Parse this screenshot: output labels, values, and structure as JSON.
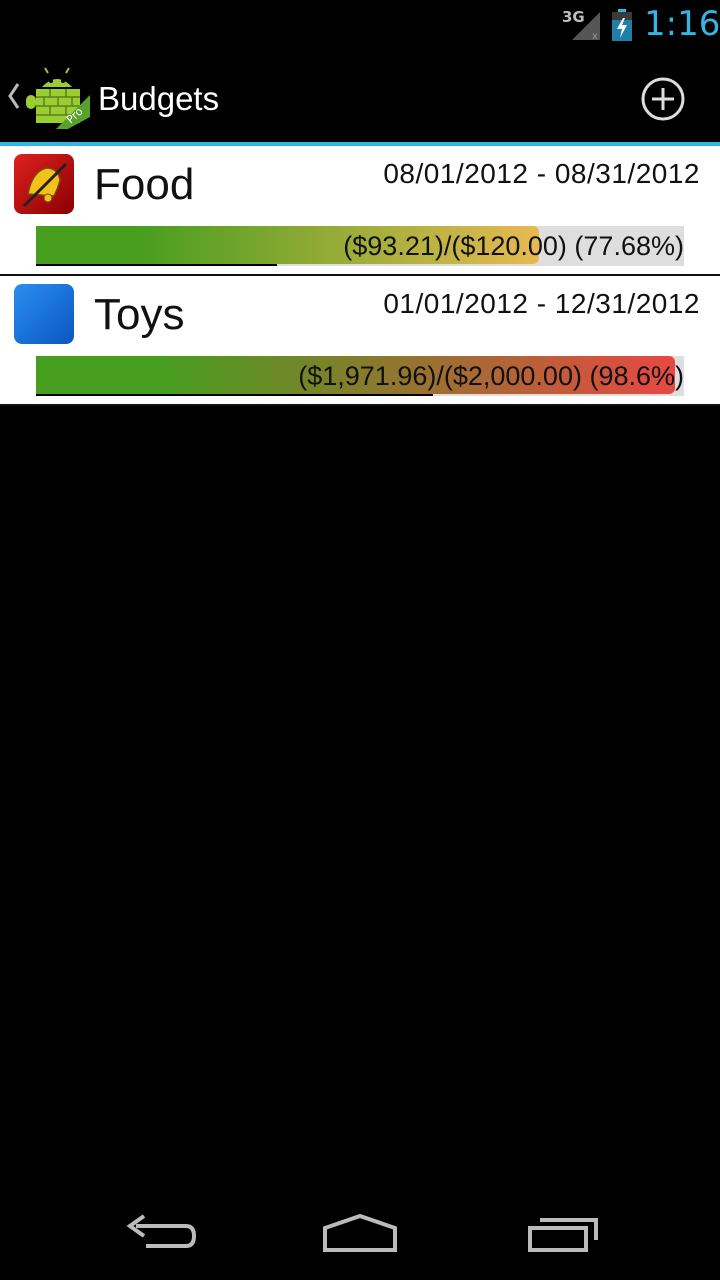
{
  "status_bar": {
    "network": "3G",
    "time": "1:16"
  },
  "action_bar": {
    "title": "Budgets",
    "logo_badge": "Pro"
  },
  "budgets": [
    {
      "name": "Food",
      "icon": "bell-icon",
      "dates": "08/01/2012 - 08/31/2012",
      "progress_text": "($93.21)/($120.00) (77.68%)",
      "percent": 77.68,
      "bar_color": "#e8b84a"
    },
    {
      "name": "Toys",
      "icon": "blue-square-icon",
      "dates": "01/01/2012 - 12/31/2012",
      "progress_text": "($1,971.96)/($2,000.00) (98.6%)",
      "percent": 98.6,
      "bar_color": "#e8403a"
    }
  ],
  "colors": {
    "accent": "#33b5e5",
    "progress_start": "#3f9a15"
  }
}
